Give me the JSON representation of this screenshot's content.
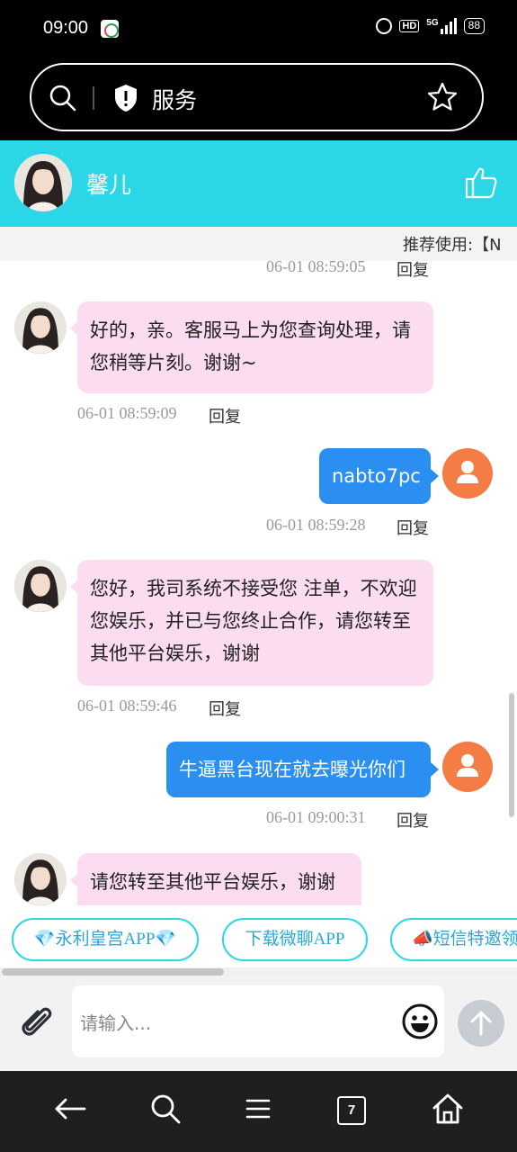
{
  "status_bar": {
    "time": "09:00",
    "hd": "HD",
    "network": "5G",
    "battery": "88"
  },
  "browser": {
    "address_text": "服务"
  },
  "chat_header": {
    "name": "馨儿"
  },
  "notice": {
    "text": "推荐使用:【N"
  },
  "messages": [
    {
      "side": "meta",
      "time": "06-01 08:59:05",
      "reply": "回复"
    },
    {
      "side": "left",
      "text": "好的，亲。客服马上为您查询处理，请您稍等片刻。谢谢~",
      "time": "06-01 08:59:09",
      "reply": "回复"
    },
    {
      "side": "right",
      "text": "nabto7pc",
      "time": "06-01 08:59:28",
      "reply": "回复"
    },
    {
      "side": "left",
      "text": "您好，我司系统不接受您 注单，不欢迎您娱乐，并已与您终止合作，请您转至其他平台娱乐，谢谢",
      "time": "06-01 08:59:46",
      "reply": "回复"
    },
    {
      "side": "right",
      "text": "牛逼黑台现在就去曝光你们",
      "time": "06-01 09:00:31",
      "reply": "回复"
    },
    {
      "side": "left",
      "text": "请您转至其他平台娱乐，谢谢"
    }
  ],
  "quick_links": [
    "💎永利皇宫APP💎",
    "下载微聊APP",
    "📣短信特邀领"
  ],
  "input": {
    "placeholder": "请输入..."
  },
  "nav": {
    "tab_count": "7"
  },
  "colors": {
    "header": "#2bd7e6",
    "left_bubble": "#fbdcf1",
    "right_bubble": "#2a8ff0",
    "user_avatar": "#f47c45"
  }
}
